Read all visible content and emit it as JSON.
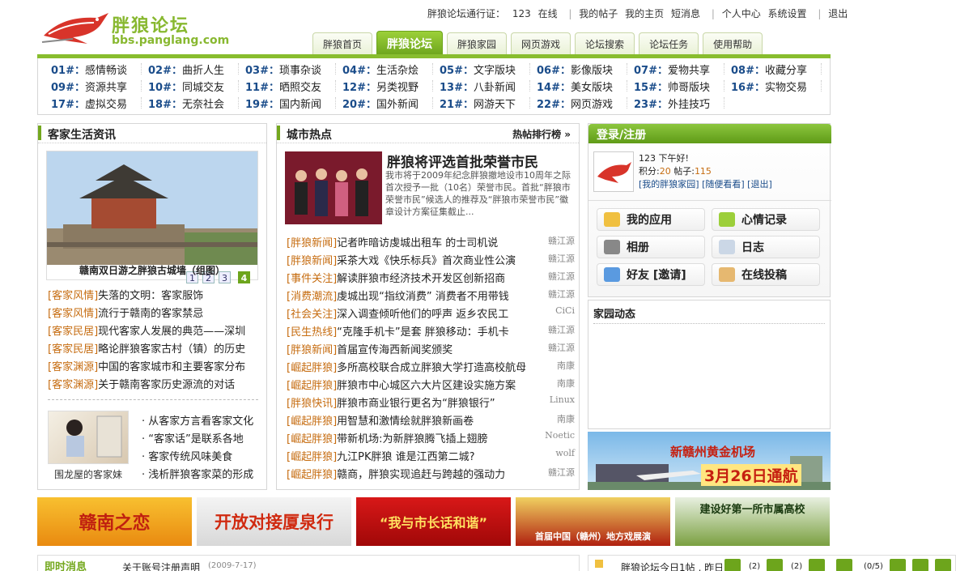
{
  "logo": {
    "name": "胖狼论坛",
    "url": "bbs.panglang.com"
  },
  "topbar": {
    "passport": "胖狼论坛通行证：",
    "user": "123",
    "online": "在线",
    "my_posts": "我的帖子",
    "my_home": "我的主页",
    "messages": "短消息",
    "center": "个人中心",
    "settings": "系统设置",
    "logout": "退出"
  },
  "nav": {
    "tabs": [
      "胖狼首页",
      "胖狼论坛",
      "胖狼家园",
      "网页游戏",
      "论坛搜索",
      "论坛任务",
      "使用帮助"
    ],
    "active": "胖狼论坛"
  },
  "forums": [
    [
      {
        "num": "01#：",
        "name": "感情畅谈"
      },
      {
        "num": "02#：",
        "name": "曲折人生"
      },
      {
        "num": "03#：",
        "name": "琐事杂谈"
      },
      {
        "num": "04#：",
        "name": "生活杂烩"
      },
      {
        "num": "05#：",
        "name": "文字版块"
      },
      {
        "num": "06#：",
        "name": "影像版块"
      },
      {
        "num": "07#：",
        "name": "爱物共享"
      },
      {
        "num": "08#：",
        "name": "收藏分享"
      }
    ],
    [
      {
        "num": "09#：",
        "name": "资源共享"
      },
      {
        "num": "10#：",
        "name": "同城交友"
      },
      {
        "num": "11#：",
        "name": "晒照交友"
      },
      {
        "num": "12#：",
        "name": "另类视野"
      },
      {
        "num": "13#：",
        "name": "八卦新闻"
      },
      {
        "num": "14#：",
        "name": "美女版块"
      },
      {
        "num": "15#：",
        "name": "帅哥版块"
      },
      {
        "num": "16#：",
        "name": "实物交易"
      }
    ],
    [
      {
        "num": "17#：",
        "name": "虚拟交易"
      },
      {
        "num": "18#：",
        "name": "无奈社会"
      },
      {
        "num": "19#：",
        "name": "国内新闻"
      },
      {
        "num": "20#：",
        "name": "国外新闻"
      },
      {
        "num": "21#：",
        "name": "网游天下"
      },
      {
        "num": "22#：",
        "name": "网页游戏"
      },
      {
        "num": "23#：",
        "name": "外挂技巧"
      }
    ]
  ],
  "left": {
    "title": "客家生活资讯",
    "pages": [
      "1",
      "2",
      "3",
      "4"
    ],
    "photo_caption": "赣南双日游之胖狼古城墙（组图）",
    "items": [
      {
        "cat": "[客家风情]",
        "text": "失落的文明：客家服饰"
      },
      {
        "cat": "[客家风情]",
        "text": "流行于赣南的客家禁忌"
      },
      {
        "cat": "[客家民居]",
        "text": "现代客家人发展的典范——深圳"
      },
      {
        "cat": "[客家民居]",
        "text": "略论胖狼客家古村（镇）的历史"
      },
      {
        "cat": "[客家渊源]",
        "text": "中国的客家城市和主要客家分布"
      },
      {
        "cat": "[客家渊源]",
        "text": "关于赣南客家历史源流的对话"
      }
    ],
    "thumb_caption": "围龙屋的客家妹",
    "list": [
      "从客家方言看客家文化",
      "“客家话”是联系各地",
      "客家传统风味美食",
      "浅析胖狼客家菜的形成"
    ]
  },
  "mid": {
    "title": "城市热点",
    "rank_link": "热帖排行榜 »",
    "headline": "胖狼将评选首批荣誉市民",
    "summary": "我市将于2009年纪念胖狼撤地设市10周年之际首次授予一批（10名）荣誉市民。首批“胖狼市荣誉市民”候选人的推荐及“胖狼市荣誉市民”徽章设计方案征集截止...",
    "items": [
      {
        "cat": "[胖狼新闻]",
        "text": "记者昨暗访虔城出租车 的士司机说",
        "src": "赣江源"
      },
      {
        "cat": "[胖狼新闻]",
        "text": "采茶大戏《快乐标兵》首次商业性公演",
        "src": "赣江源"
      },
      {
        "cat": "[事件关注]",
        "text": "解读胖狼市经济技术开发区创新招商",
        "src": "赣江源"
      },
      {
        "cat": "[消费潮流]",
        "text": "虔城出现“指纹消费” 消费者不用带钱",
        "src": "赣江源"
      },
      {
        "cat": "[社会关注]",
        "text": "深入调查倾听他们的呼声 返乡农民工",
        "src": "CiCi"
      },
      {
        "cat": "[民生热线]",
        "text": "“克隆手机卡”是套 胖狼移动：手机卡",
        "src": "赣江源"
      },
      {
        "cat": "[胖狼新闻]",
        "text": "首届宣传海西新闻奖颁奖",
        "src": "赣江源"
      },
      {
        "cat": "[崛起胖狼]",
        "text": "多所高校联合成立胖狼大学打造高校航母",
        "src": "南康"
      },
      {
        "cat": "[崛起胖狼]",
        "text": "胖狼市中心城区六大片区建设实施方案",
        "src": "南康"
      },
      {
        "cat": "[胖狼快讯]",
        "text": "胖狼市商业银行更名为“胖狼银行”",
        "src": "Linux"
      },
      {
        "cat": "[崛起胖狼]",
        "text": "用智慧和激情绘就胖狼新画卷",
        "src": "南康"
      },
      {
        "cat": "[崛起胖狼]",
        "text": "带新机场:为新胖狼腾飞插上翅膀",
        "src": "Noetic"
      },
      {
        "cat": "[崛起胖狼]",
        "text": "九江PK胖狼 谁是江西第二城?",
        "src": "wolf"
      },
      {
        "cat": "[崛起胖狼]",
        "text": "赣商，胖狼实现追赶与跨越的强动力",
        "src": "赣江源"
      }
    ]
  },
  "login": {
    "title": "登录/注册",
    "greeting": "123 下午好!",
    "points_label": "积分:",
    "points": "20",
    "posts_label": "帖子:",
    "posts": "115",
    "links": "[我的胖狼家园] [随便看看] [退出]",
    "buttons": [
      "我的应用",
      "心情记录",
      "相册",
      "日志",
      "好友 [邀请]",
      "在线投稿"
    ]
  },
  "home": {
    "title": "家园动态"
  },
  "ad_right": {
    "line1": "新赣州黄金机场",
    "line2": "3月26日通航"
  },
  "banners": [
    "赣南之恋",
    "开放对接厦泉行",
    "“我与市长话和谐”",
    "首届中国（赣州）地方戏展演",
    "建设好第一所市属高校"
  ],
  "bottom": {
    "left_title": "即时消息",
    "left_text": "关于账号注册声明",
    "left_date": "(2009-7-17)",
    "right_text": "胖狼论坛今日1帖 , 昨日",
    "right_counts": [
      "(2)",
      "(2)",
      "(0/5)"
    ]
  },
  "colors": {
    "accent": "#74a81e",
    "cat": "#c66c10",
    "link": "#1a4c8a"
  }
}
